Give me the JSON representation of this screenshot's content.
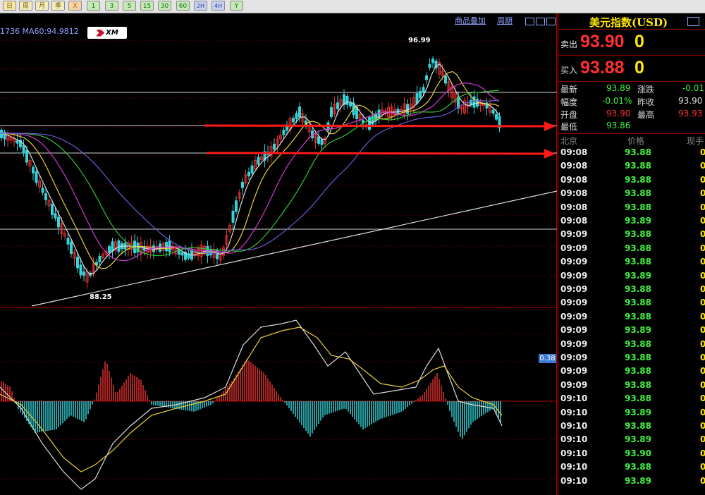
{
  "toolbar": {
    "buttons": [
      "日",
      "周",
      "月",
      "季",
      "X",
      "1",
      "3",
      "5",
      "15",
      "30",
      "60",
      "2H",
      "4H",
      "Y"
    ]
  },
  "chart": {
    "indicator_text": "1736  MA60:94.9812",
    "logo_text": "XM",
    "menu_add": "商品叠加",
    "menu_period": "周期",
    "high_label": "96.99",
    "low_label": "88.25",
    "osc_value": "0.38",
    "colors": {
      "bull": "#e23030",
      "bear": "#35d2d8",
      "ma_white": "#dddddd",
      "ma_yellow": "#e8d23a",
      "ma_magenta": "#d23ad2",
      "ma_green": "#35c635",
      "ma_blue": "#6a5ad8",
      "arrow": "#ff1a1a"
    }
  },
  "panel": {
    "title": "美元指数(USD)",
    "sell_label": "卖出",
    "sell_price": "93.90",
    "sell_vol": "0",
    "buy_label": "买入",
    "buy_price": "93.88",
    "buy_vol": "0",
    "stats": {
      "latest_label": "最新",
      "latest": "93.89",
      "change_label": "涨跌",
      "change": "-0.01",
      "range_label": "幅度",
      "range": "-0.01%",
      "prev_label": "昨收",
      "prev": "93.90",
      "open_label": "开盘",
      "open": "93.90",
      "high_label": "最高",
      "high": "93.93",
      "low_label": "最低",
      "low": "93.86"
    },
    "tick_headers": [
      "北京",
      "价格",
      "现手"
    ],
    "ticks": [
      [
        "09:08",
        "93.88",
        "0"
      ],
      [
        "09:08",
        "93.88",
        "0"
      ],
      [
        "09:08",
        "93.88",
        "0"
      ],
      [
        "09:08",
        "93.88",
        "0"
      ],
      [
        "09:08",
        "93.88",
        "0"
      ],
      [
        "09:08",
        "93.89",
        "0"
      ],
      [
        "09:09",
        "93.88",
        "0"
      ],
      [
        "09:09",
        "93.88",
        "0"
      ],
      [
        "09:09",
        "93.88",
        "0"
      ],
      [
        "09:09",
        "93.89",
        "0"
      ],
      [
        "09:09",
        "93.88",
        "0"
      ],
      [
        "09:09",
        "93.88",
        "0"
      ],
      [
        "09:09",
        "93.88",
        "0"
      ],
      [
        "09:09",
        "93.89",
        "0"
      ],
      [
        "09:09",
        "93.88",
        "0"
      ],
      [
        "09:09",
        "93.88",
        "0"
      ],
      [
        "09:09",
        "93.88",
        "0"
      ],
      [
        "09:09",
        "93.88",
        "0"
      ],
      [
        "09:10",
        "93.88",
        "0"
      ],
      [
        "09:10",
        "93.89",
        "0"
      ],
      [
        "09:10",
        "93.88",
        "0"
      ],
      [
        "09:10",
        "93.89",
        "0"
      ],
      [
        "09:10",
        "93.90",
        "0"
      ],
      [
        "09:10",
        "93.88",
        "0"
      ],
      [
        "09:10",
        "93.89",
        "0"
      ]
    ]
  }
}
